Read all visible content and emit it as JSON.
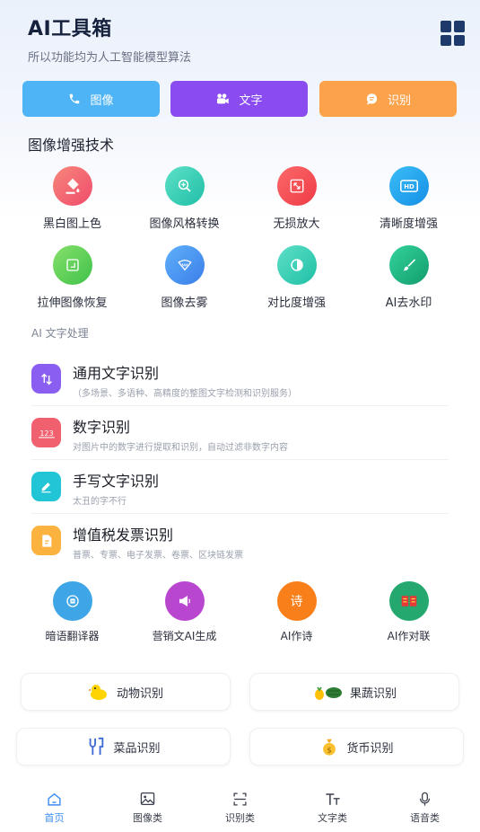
{
  "header": {
    "title": "AI工具箱",
    "subtitle": "所以功能均为人工智能模型算法"
  },
  "top_buttons": [
    {
      "label": "图像",
      "icon": "phone-icon",
      "color": "#4fb4f6"
    },
    {
      "label": "文字",
      "icon": "camera-icon",
      "color": "#8a4cf0"
    },
    {
      "label": "识别",
      "icon": "chat-icon",
      "color": "#fba24a"
    }
  ],
  "image_section": {
    "title": "图像增强技术",
    "tools": [
      {
        "label": "黑白图上色",
        "icon": "paint-bucket-icon",
        "color": "#f0596b"
      },
      {
        "label": "图像风格转换",
        "icon": "zoom-in-icon",
        "color": "#2fcfb8"
      },
      {
        "label": "无损放大",
        "icon": "expand-icon",
        "color": "#f6454f"
      },
      {
        "label": "清晰度增强",
        "icon": "hd-icon",
        "color": "#1ea2ef"
      },
      {
        "label": "拉伸图像恢复",
        "icon": "crop-icon",
        "color": "#4fcc4a"
      },
      {
        "label": "图像去雾",
        "icon": "defog-icon",
        "color": "#4a8ff0"
      },
      {
        "label": "对比度增强",
        "icon": "contrast-icon",
        "color": "#2fcfb8"
      },
      {
        "label": "AI去水印",
        "icon": "brush-icon",
        "color": "#1fb889"
      }
    ]
  },
  "text_section": {
    "title": "AI 文字处理",
    "items": [
      {
        "title": "通用文字识别",
        "desc": "（多场景、多语种、高精度的整图文字检测和识别服务）",
        "icon": "sort-icon",
        "color": "#8a5ef0"
      },
      {
        "title": "数字识别",
        "desc": "对图片中的数字进行提取和识别，自动过滤非数字内容",
        "icon": "number-123-icon",
        "color": "#f0606e"
      },
      {
        "title": "手写文字识别",
        "desc": "太丑的字不行",
        "icon": "pen-icon",
        "color": "#22c5d6"
      },
      {
        "title": "增值税发票识别",
        "desc": "普票、专票、电子发票、卷票、区块链发票",
        "icon": "invoice-icon",
        "color": "#fbb23f"
      }
    ]
  },
  "fun_tools": [
    {
      "label": "暗语翻译器",
      "icon": "translate-icon",
      "color": "#3ea6e6",
      "glyph": ""
    },
    {
      "label": "营销文AI生成",
      "icon": "megaphone-icon",
      "color": "#b846cf",
      "glyph": ""
    },
    {
      "label": "AI作诗",
      "icon": "poem-icon",
      "color": "#f97f1a",
      "glyph": "诗"
    },
    {
      "label": "AI作对联",
      "icon": "couplet-icon",
      "color": "#24a86f",
      "glyph": ""
    }
  ],
  "cards": [
    {
      "label": "动物识别",
      "icon": "duck-icon"
    },
    {
      "label": "果蔬识别",
      "icon": "fruit-icon"
    },
    {
      "label": "菜品识别",
      "icon": "utensils-icon"
    },
    {
      "label": "货币识别",
      "icon": "money-bag-icon"
    }
  ],
  "tabbar": [
    {
      "label": "首页",
      "icon": "home-icon",
      "active": true
    },
    {
      "label": "图像类",
      "icon": "image-icon",
      "active": false
    },
    {
      "label": "识别类",
      "icon": "scan-icon",
      "active": false
    },
    {
      "label": "文字类",
      "icon": "text-icon",
      "active": false
    },
    {
      "label": "语音类",
      "icon": "mic-icon",
      "active": false
    }
  ]
}
